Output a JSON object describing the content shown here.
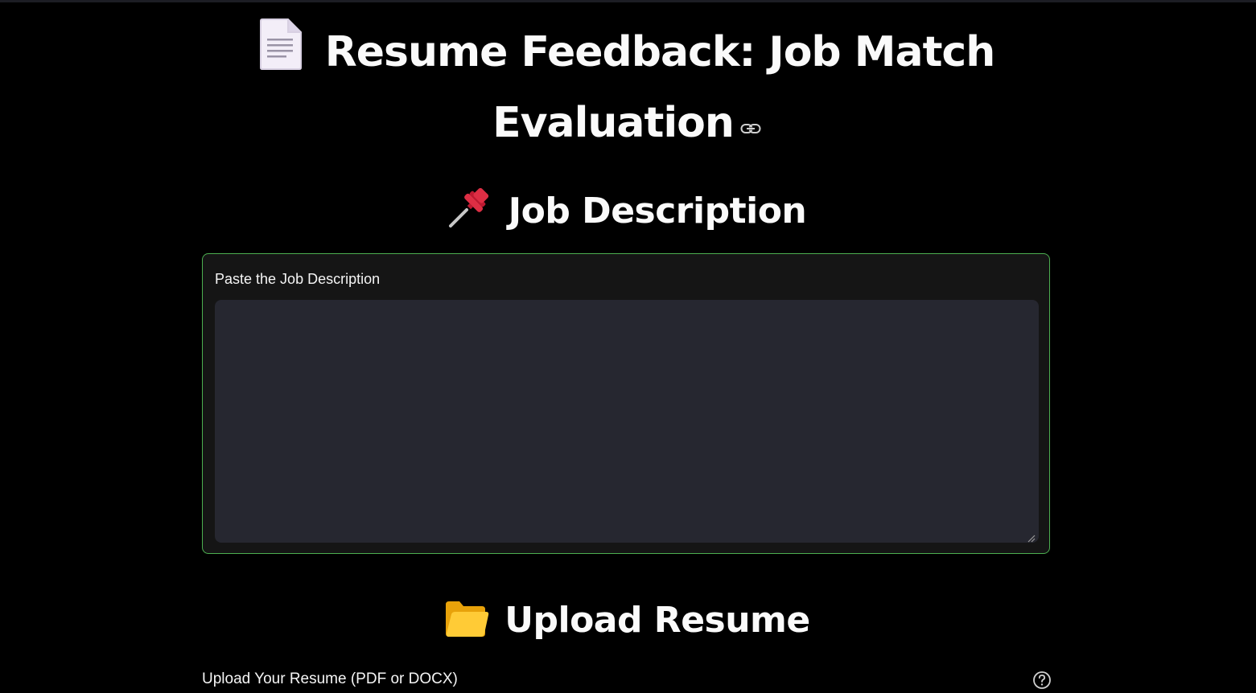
{
  "header": {
    "title_line1": "Resume Feedback: Job Match",
    "title_line2": "Evaluation",
    "title_icon": "page-document-icon",
    "anchor_icon": "link-icon"
  },
  "job_section": {
    "heading": "Job Description",
    "icon": "pushpin-icon",
    "field_label": "Paste the Job Description",
    "field_value": "",
    "field_placeholder": ""
  },
  "upload_section": {
    "heading": "Upload Resume",
    "icon": "folder-icon",
    "uploader_label": "Upload Your Resume (PDF or DOCX)",
    "help_icon": "help-circle-icon"
  },
  "colors": {
    "background": "#000000",
    "text": "#fafafa",
    "input_bg": "#262730",
    "form_border": "#4caf50"
  }
}
